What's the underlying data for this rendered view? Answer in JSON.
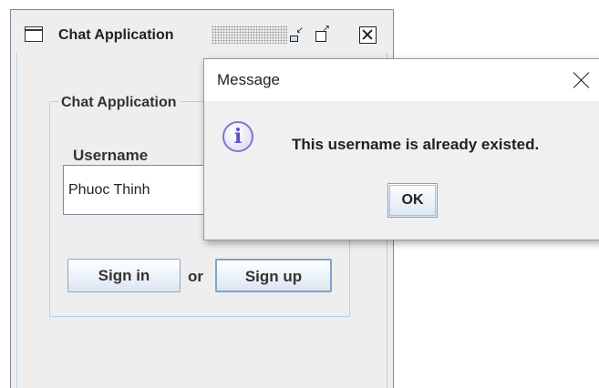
{
  "window": {
    "title": "Chat Application",
    "group_title": "Chat Application",
    "username_label": "Username",
    "username_value": "Phuoc Thinh",
    "signin_label": "Sign in",
    "or_label": "or",
    "signup_label": "Sign up",
    "title_icons": [
      "window-icon",
      "minimize-icon",
      "maximize-icon",
      "close-icon"
    ]
  },
  "dialog": {
    "title": "Message",
    "message": "This username is already existed.",
    "ok_label": "OK",
    "icon": "info-icon",
    "info_glyph": "i"
  },
  "colors": {
    "window_bg": "#eeeeee",
    "border_accent": "#b8cfe5",
    "info_icon": "#7c78c8"
  }
}
